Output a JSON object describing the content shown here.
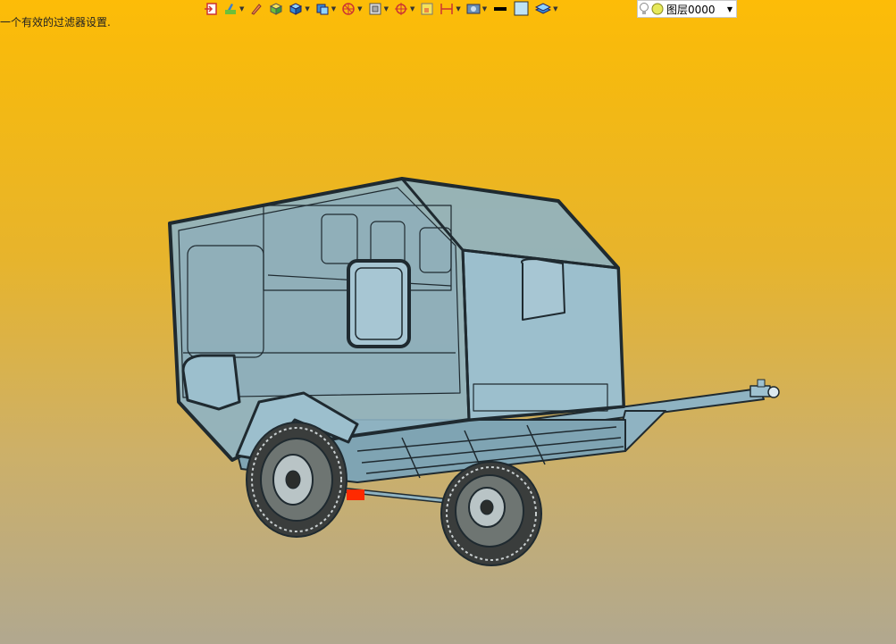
{
  "status": {
    "message": "一个有效的过滤器设置."
  },
  "toolbar": {
    "buttons": [
      {
        "icon": "import-icon",
        "dropdown": false
      },
      {
        "icon": "paint-brush-icon",
        "dropdown": true
      },
      {
        "icon": "pen-icon",
        "dropdown": false
      },
      {
        "icon": "box-face-icon",
        "dropdown": false
      },
      {
        "icon": "solid-box-icon",
        "dropdown": true
      },
      {
        "icon": "view-cube-icon",
        "dropdown": true
      },
      {
        "icon": "wheel-icon",
        "dropdown": true
      },
      {
        "icon": "frame-icon",
        "dropdown": true
      },
      {
        "icon": "snap-target-icon",
        "dropdown": true
      },
      {
        "icon": "select-box-icon",
        "dropdown": false
      },
      {
        "icon": "dimension-icon",
        "dropdown": true
      },
      {
        "icon": "render-icon",
        "dropdown": true
      },
      {
        "icon": "line-color-icon",
        "dropdown": false
      },
      {
        "icon": "fill-color-icon",
        "dropdown": false
      },
      {
        "icon": "layers-icon",
        "dropdown": true
      }
    ],
    "layer": {
      "name": "图层0000",
      "icons": [
        "lightbulb-icon",
        "layer-visibility-icon"
      ]
    }
  },
  "colors": {
    "background_top": "#fdbc07",
    "background_bottom": "#b1a88f",
    "model_fill": "#8fb3c2",
    "model_edge": "#1f2a30",
    "axis_red": "#ff2a00"
  }
}
